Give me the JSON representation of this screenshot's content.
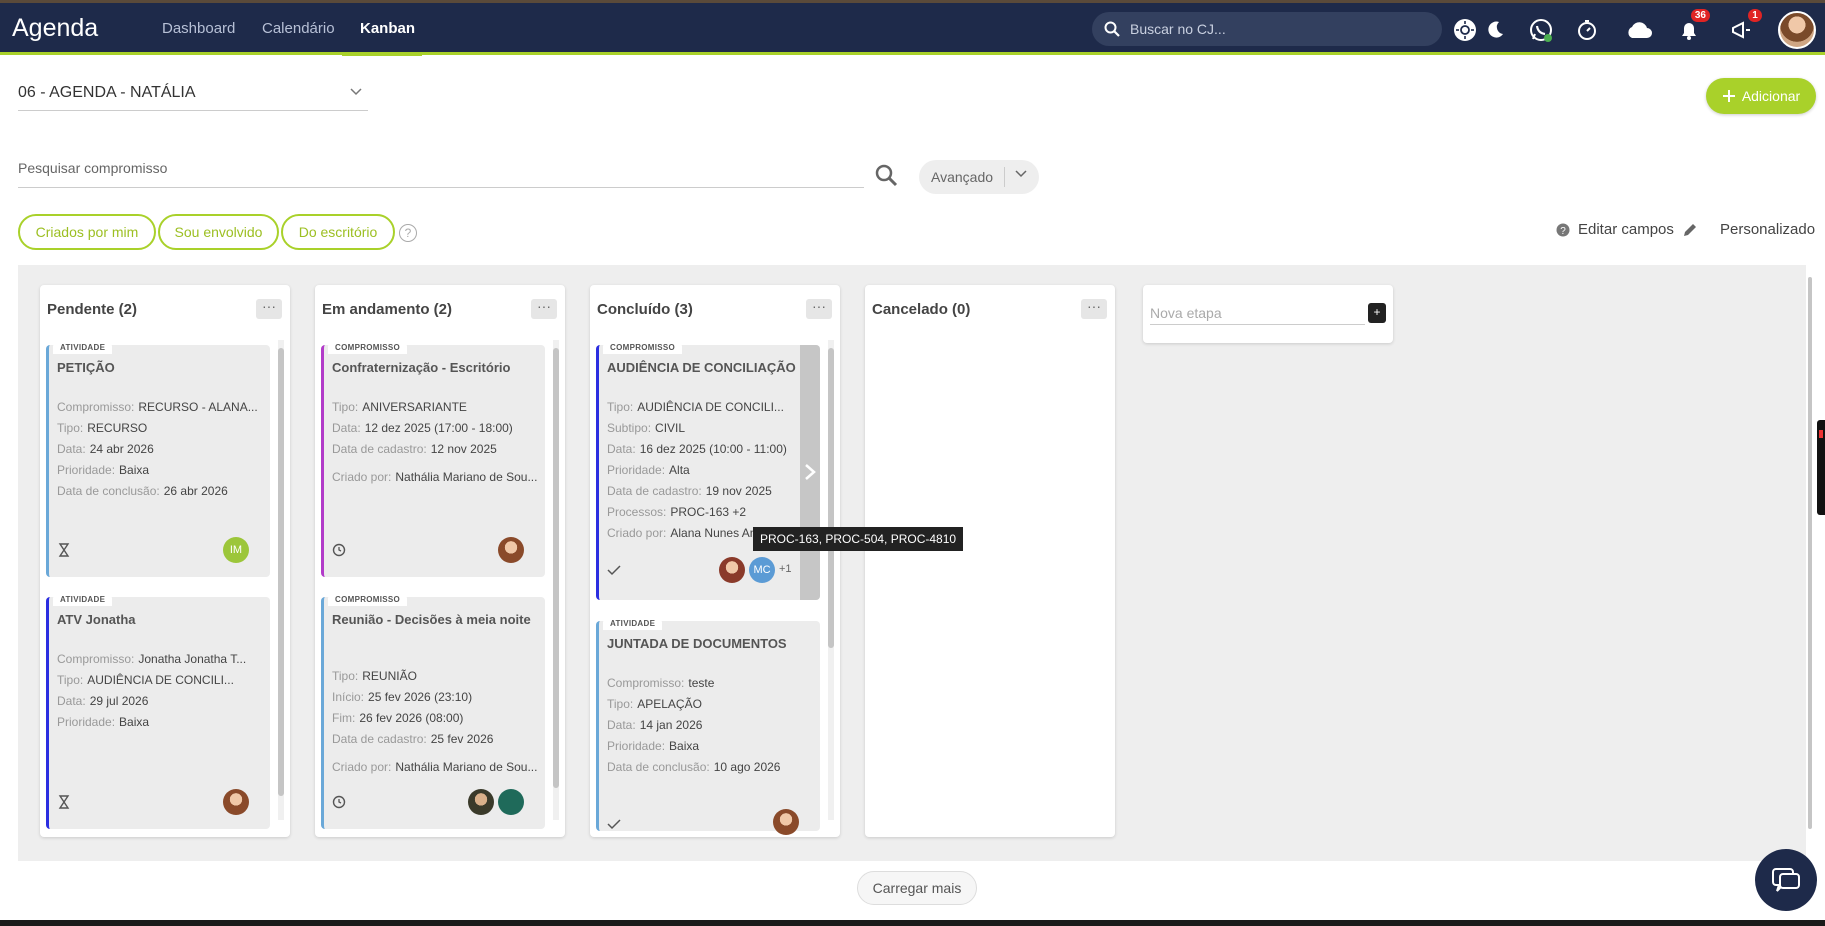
{
  "header": {
    "app_title": "Agenda",
    "nav": [
      "Dashboard",
      "Calendário",
      "Kanban"
    ],
    "active_nav": "Kanban",
    "search_placeholder": "Buscar no CJ...",
    "notifications_count": "36",
    "alerts_count": "1",
    "icons": [
      "sun-icon",
      "moon-icon",
      "whatsapp-icon",
      "timer-icon",
      "cloud-icon",
      "bell-icon",
      "megaphone-icon"
    ]
  },
  "toolbar": {
    "agenda_name": "06 - AGENDA - NATÁLIA",
    "add_label": "Adicionar",
    "search_placeholder": "Pesquisar compromisso",
    "advanced_label": "Avançado"
  },
  "filters": [
    "Criados por mim",
    "Sou envolvido",
    "Do escritório"
  ],
  "options": {
    "edit_fields": "Editar campos",
    "custom": "Personalizado"
  },
  "colors": {
    "navbar": "#1e2a4a",
    "accent": "#a9d12a"
  },
  "columns": [
    {
      "title": "Pendente (2)",
      "cards": [
        {
          "tag": "ATIVIDADE",
          "title": "PETIÇÃO",
          "fields": [
            {
              "label": "Compromisso:",
              "value": "RECURSO - ALANA..."
            },
            {
              "label": "Tipo:",
              "value": "RECURSO"
            },
            {
              "label": "Data:",
              "value": "24 abr 2026"
            },
            {
              "label": "Prioridade:",
              "value": "Baixa"
            },
            {
              "label": "Data de conclusão:",
              "value": "26 abr 2026"
            }
          ],
          "avatar_initials": "IM"
        },
        {
          "tag": "ATIVIDADE",
          "title": "ATV Jonatha",
          "fields": [
            {
              "label": "Compromisso:",
              "value": "Jonatha Jonatha T..."
            },
            {
              "label": "Tipo:",
              "value": "AUDIÊNCIA DE CONCILI..."
            },
            {
              "label": "Data:",
              "value": "29 jul 2026"
            },
            {
              "label": "Prioridade:",
              "value": "Baixa"
            }
          ]
        }
      ]
    },
    {
      "title": "Em andamento (2)",
      "cards": [
        {
          "tag": "COMPROMISSO",
          "title": "Confraternização - Escritório",
          "fields": [
            {
              "label": "Tipo:",
              "value": "ANIVERSARIANTE"
            },
            {
              "label": "Data:",
              "value": "12 dez 2025 (17:00 - 18:00)"
            },
            {
              "label": "Data de cadastro:",
              "value": "12 nov 2025"
            },
            {
              "label": "Criado por:",
              "value": "Nathália Mariano de Sou..."
            }
          ]
        },
        {
          "tag": "COMPROMISSO",
          "title": "Reunião - Decisões à meia noite",
          "fields": [
            {
              "label": "Tipo:",
              "value": "REUNIÃO"
            },
            {
              "label": "Início:",
              "value": "25 fev 2026 (23:10)"
            },
            {
              "label": "Fim:",
              "value": "26 fev 2026 (08:00)"
            },
            {
              "label": "Data de cadastro:",
              "value": "25 fev 2026"
            },
            {
              "label": "Criado por:",
              "value": "Nathália Mariano de Sou..."
            }
          ]
        }
      ]
    },
    {
      "title": "Concluído (3)",
      "cards": [
        {
          "tag": "COMPROMISSO",
          "title": "AUDIÊNCIA DE CONCILIAÇÃO",
          "fields": [
            {
              "label": "Tipo:",
              "value": "AUDIÊNCIA DE CONCILI..."
            },
            {
              "label": "Subtipo:",
              "value": "CIVIL"
            },
            {
              "label": "Data:",
              "value": "16 dez 2025 (10:00 - 11:00)"
            },
            {
              "label": "Prioridade:",
              "value": "Alta"
            },
            {
              "label": "Data de cadastro:",
              "value": "19 nov 2025"
            },
            {
              "label": "Processos:",
              "value": "PROC-163 +2"
            },
            {
              "label": "Criado por:",
              "value": "Alana Nunes An..."
            }
          ],
          "avatar_initials": "MC",
          "more_count": "+1"
        },
        {
          "tag": "ATIVIDADE",
          "title": "JUNTADA DE DOCUMENTOS",
          "fields": [
            {
              "label": "Compromisso:",
              "value": "teste"
            },
            {
              "label": "Tipo:",
              "value": "APELAÇÃO"
            },
            {
              "label": "Data:",
              "value": "14 jan 2026"
            },
            {
              "label": "Prioridade:",
              "value": "Baixa"
            },
            {
              "label": "Data de conclusão:",
              "value": "10 ago 2026"
            }
          ]
        }
      ]
    },
    {
      "title": "Cancelado (0)",
      "cards": []
    }
  ],
  "new_stage_placeholder": "Nova etapa",
  "new_stage_button": "+",
  "menu_label": "···",
  "tooltip": "PROC-163, PROC-504, PROC-4810",
  "load_more": "Carregar mais"
}
